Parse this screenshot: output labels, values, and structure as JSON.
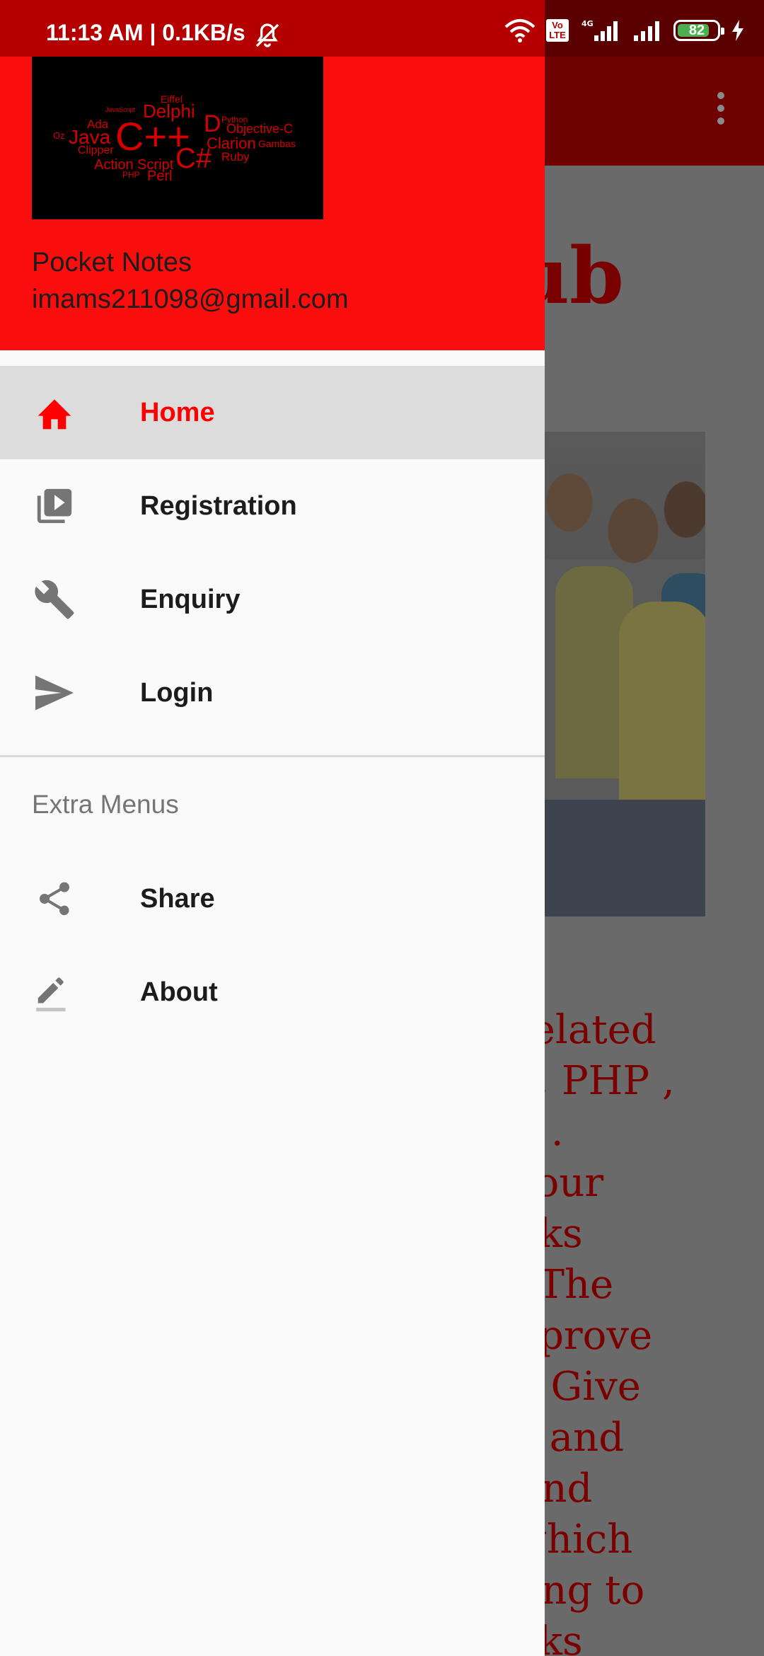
{
  "status_bar": {
    "time_text": "11:13 AM | 0.1KB/s",
    "volte_label": "Vo\nLTE",
    "network_label": "4G",
    "battery_level": "82",
    "battery_fraction": 0.82
  },
  "background": {
    "title_fragment": "ub",
    "paragraph_lines": [
      "related",
      "a, PHP ,",
      "n .",
      "your",
      "nks",
      ". The",
      "nprove",
      "l. Give",
      "k and",
      "And",
      "which",
      "ting to",
      "nks"
    ]
  },
  "drawer": {
    "logo_words": [
      "Eiffel",
      "Delphi",
      "D",
      "Python",
      "Objective-C",
      "Ada",
      "Java",
      "C++",
      "Clarion",
      "Gambas",
      "Clipper",
      "Action Script",
      "C#",
      "Ruby",
      "Perl",
      "PHP",
      "Oz",
      "JavaScript"
    ],
    "header_title": "Pocket Notes",
    "header_email": "imams211098@gmail.com",
    "items": [
      {
        "label": "Home",
        "icon": "home-icon",
        "active": true
      },
      {
        "label": "Registration",
        "icon": "video-library-icon",
        "active": false
      },
      {
        "label": "Enquiry",
        "icon": "wrench-icon",
        "active": false
      },
      {
        "label": "Login",
        "icon": "send-icon",
        "active": false
      }
    ],
    "section_title": "Extra Menus",
    "extra_items": [
      {
        "label": "Share",
        "icon": "share-icon"
      },
      {
        "label": "About",
        "icon": "edit-icon"
      }
    ]
  },
  "colors": {
    "accent": "#ff0000",
    "drawer_header": "#fa0d0d",
    "status_bar": "#b50000",
    "icon_gray": "#757575"
  }
}
